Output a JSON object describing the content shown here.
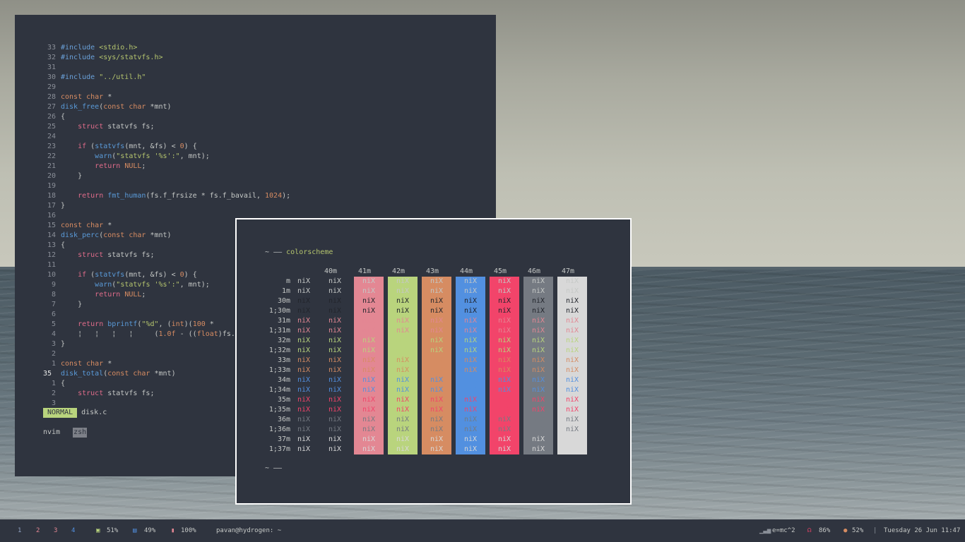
{
  "editor": {
    "lines": [
      {
        "num": "33",
        "segs": [
          [
            "pre",
            "#include "
          ],
          [
            "str",
            "<stdio.h>"
          ]
        ]
      },
      {
        "num": "32",
        "segs": [
          [
            "pre",
            "#include "
          ],
          [
            "str",
            "<sys/statvfs.h>"
          ]
        ]
      },
      {
        "num": "31",
        "segs": []
      },
      {
        "num": "30",
        "segs": [
          [
            "pre",
            "#include "
          ],
          [
            "str",
            "\"../util.h\""
          ]
        ]
      },
      {
        "num": "29",
        "segs": []
      },
      {
        "num": "28",
        "segs": [
          [
            "type",
            "const char"
          ],
          [
            "plain",
            " *"
          ]
        ]
      },
      {
        "num": "27",
        "segs": [
          [
            "fn",
            "disk_free"
          ],
          [
            "plain",
            "("
          ],
          [
            "type",
            "const char"
          ],
          [
            "plain",
            " *mnt)"
          ]
        ]
      },
      {
        "num": "26",
        "segs": [
          [
            "plain",
            "{"
          ]
        ]
      },
      {
        "num": "25",
        "segs": [
          [
            "plain",
            "    "
          ],
          [
            "kw",
            "struct"
          ],
          [
            "plain",
            " statvfs fs;"
          ]
        ]
      },
      {
        "num": "24",
        "segs": []
      },
      {
        "num": "23",
        "segs": [
          [
            "plain",
            "    "
          ],
          [
            "kw",
            "if"
          ],
          [
            "plain",
            " ("
          ],
          [
            "fn",
            "statvfs"
          ],
          [
            "plain",
            "(mnt, &fs) < "
          ],
          [
            "num",
            "0"
          ],
          [
            "plain",
            ") {"
          ]
        ]
      },
      {
        "num": "22",
        "segs": [
          [
            "plain",
            "        "
          ],
          [
            "fn",
            "warn"
          ],
          [
            "plain",
            "("
          ],
          [
            "str",
            "\"statvfs '%s':\""
          ],
          [
            "plain",
            ", mnt);"
          ]
        ]
      },
      {
        "num": "21",
        "segs": [
          [
            "plain",
            "        "
          ],
          [
            "kw",
            "return"
          ],
          [
            "plain",
            " "
          ],
          [
            "null",
            "NULL"
          ],
          [
            "plain",
            ";"
          ]
        ]
      },
      {
        "num": "20",
        "segs": [
          [
            "plain",
            "    }"
          ]
        ]
      },
      {
        "num": "19",
        "segs": []
      },
      {
        "num": "18",
        "segs": [
          [
            "plain",
            "    "
          ],
          [
            "kw",
            "return"
          ],
          [
            "plain",
            " "
          ],
          [
            "fn",
            "fmt_human"
          ],
          [
            "plain",
            "(fs.f_frsize * fs.f_bavail, "
          ],
          [
            "num",
            "1024"
          ],
          [
            "plain",
            ");"
          ]
        ]
      },
      {
        "num": "17",
        "segs": [
          [
            "plain",
            "}"
          ]
        ]
      },
      {
        "num": "16",
        "segs": []
      },
      {
        "num": "15",
        "segs": [
          [
            "type",
            "const char"
          ],
          [
            "plain",
            " *"
          ]
        ]
      },
      {
        "num": "14",
        "segs": [
          [
            "fn",
            "disk_perc"
          ],
          [
            "plain",
            "("
          ],
          [
            "type",
            "const char"
          ],
          [
            "plain",
            " *mnt)"
          ]
        ]
      },
      {
        "num": "13",
        "segs": [
          [
            "plain",
            "{"
          ]
        ]
      },
      {
        "num": "12",
        "segs": [
          [
            "plain",
            "    "
          ],
          [
            "kw",
            "struct"
          ],
          [
            "plain",
            " statvfs fs;"
          ]
        ]
      },
      {
        "num": "11",
        "segs": []
      },
      {
        "num": "10",
        "segs": [
          [
            "plain",
            "    "
          ],
          [
            "kw",
            "if"
          ],
          [
            "plain",
            " ("
          ],
          [
            "fn",
            "statvfs"
          ],
          [
            "plain",
            "(mnt, &fs) < "
          ],
          [
            "num",
            "0"
          ],
          [
            "plain",
            ") {"
          ]
        ]
      },
      {
        "num": "9",
        "segs": [
          [
            "plain",
            "        "
          ],
          [
            "fn",
            "warn"
          ],
          [
            "plain",
            "("
          ],
          [
            "str",
            "\"statvfs '%s':\""
          ],
          [
            "plain",
            ", mnt);"
          ]
        ]
      },
      {
        "num": "8",
        "segs": [
          [
            "plain",
            "        "
          ],
          [
            "kw",
            "return"
          ],
          [
            "plain",
            " "
          ],
          [
            "null",
            "NULL"
          ],
          [
            "plain",
            ";"
          ]
        ]
      },
      {
        "num": "7",
        "segs": [
          [
            "plain",
            "    }"
          ]
        ]
      },
      {
        "num": "6",
        "segs": []
      },
      {
        "num": "5",
        "segs": [
          [
            "plain",
            "    "
          ],
          [
            "kw",
            "return"
          ],
          [
            "plain",
            " "
          ],
          [
            "fn",
            "bprintf"
          ],
          [
            "plain",
            "("
          ],
          [
            "str",
            "\"%d\""
          ],
          [
            "plain",
            ", ("
          ],
          [
            "type",
            "int"
          ],
          [
            "plain",
            ")("
          ],
          [
            "num",
            "100"
          ],
          [
            "plain",
            " *"
          ]
        ]
      },
      {
        "num": "4",
        "segs": [
          [
            "guide",
            "    ¦   ¦   ¦   ¦   "
          ],
          [
            "plain",
            "  ("
          ],
          [
            "num",
            "1.0f"
          ],
          [
            "plain",
            " - (("
          ],
          [
            "type",
            "float"
          ],
          [
            "plain",
            ")fs.f_b"
          ]
        ]
      },
      {
        "num": "3",
        "segs": [
          [
            "plain",
            "}"
          ]
        ]
      },
      {
        "num": "2",
        "segs": []
      },
      {
        "num": "1",
        "segs": [
          [
            "type",
            "const char"
          ],
          [
            "plain",
            " *"
          ]
        ]
      },
      {
        "num": "35",
        "cur": true,
        "segs": [
          [
            "fn",
            "disk_total"
          ],
          [
            "plain",
            "("
          ],
          [
            "type",
            "const char"
          ],
          [
            "plain",
            " *mnt)"
          ]
        ]
      },
      {
        "num": "1",
        "segs": [
          [
            "plain",
            "{"
          ]
        ]
      },
      {
        "num": "2",
        "segs": [
          [
            "plain",
            "    "
          ],
          [
            "kw",
            "struct"
          ],
          [
            "plain",
            " statvfs fs;"
          ]
        ]
      },
      {
        "num": "3",
        "segs": []
      }
    ],
    "mode": "NORMAL",
    "filename": "disk.c",
    "tmux_windows": [
      "nvim",
      "zsh"
    ]
  },
  "colorscheme": {
    "prompt_tilde": "~",
    "prompt_arrow": "——",
    "command": "colorscheme",
    "end_prompt": "~ ——",
    "sample": "niX",
    "bg_headers": [
      "40m",
      "41m",
      "42m",
      "43m",
      "44m",
      "45m",
      "46m",
      "47m"
    ],
    "bg_colors": [
      "#2f343f",
      "#e38793",
      "#b9d47d",
      "#d68c62",
      "#5290e0",
      "#f2446a",
      "#757a82",
      "#d8d8d8"
    ],
    "fg_rows": [
      {
        "label": "m",
        "color": "#c5c8c6"
      },
      {
        "label": "1m",
        "color": "#c5c8c6"
      },
      {
        "label": "30m",
        "color": "#22252c"
      },
      {
        "label": "1;30m",
        "color": "#22252c"
      },
      {
        "label": "31m",
        "color": "#e38793"
      },
      {
        "label": "1;31m",
        "color": "#e38793"
      },
      {
        "label": "32m",
        "color": "#b9d47d"
      },
      {
        "label": "1;32m",
        "color": "#b9d47d"
      },
      {
        "label": "33m",
        "color": "#d68c62"
      },
      {
        "label": "1;33m",
        "color": "#d68c62"
      },
      {
        "label": "34m",
        "color": "#5290e0"
      },
      {
        "label": "1;34m",
        "color": "#5290e0"
      },
      {
        "label": "35m",
        "color": "#f2446a"
      },
      {
        "label": "1;35m",
        "color": "#f2446a"
      },
      {
        "label": "36m",
        "color": "#757a82"
      },
      {
        "label": "1;36m",
        "color": "#757a82"
      },
      {
        "label": "37m",
        "color": "#d8d8d8"
      },
      {
        "label": "1;37m",
        "color": "#d8d8d8"
      }
    ]
  },
  "statusbar": {
    "workspaces": [
      {
        "label": "1",
        "color": "#8fa0c0"
      },
      {
        "label": "2",
        "color": "#e38793"
      },
      {
        "label": "3",
        "color": "#e38793"
      },
      {
        "label": "4",
        "color": "#5290e0"
      }
    ],
    "cpu": "51%",
    "memory": "49%",
    "battery": "100%",
    "user": "pavan@hydrogen: ~",
    "formula": "e=mc^2",
    "volume": "86%",
    "brightness": "52%",
    "datetime": "Tuesday 26 Jun 11:47",
    "colors": {
      "cpu": "#b9d47d",
      "memory": "#5290e0",
      "battery": "#e38793",
      "volume": "#f2446a",
      "brightness": "#d68c62"
    }
  }
}
